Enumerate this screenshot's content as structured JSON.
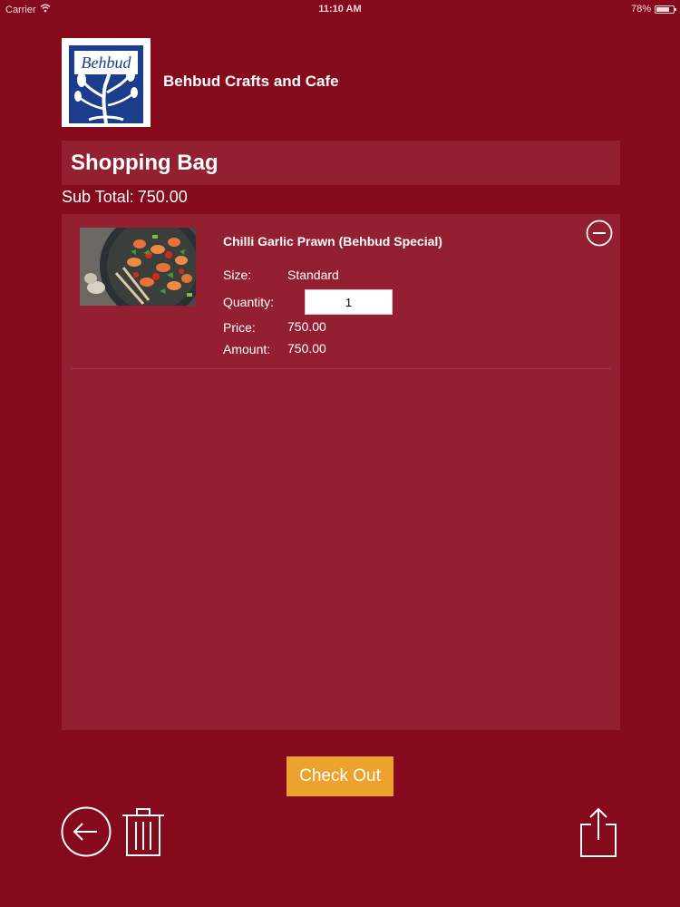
{
  "status_bar": {
    "carrier": "Carrier",
    "time": "11:10 AM",
    "battery": "78%",
    "battery_level": 0.78
  },
  "brand": {
    "name": "Behbud Crafts and Cafe",
    "logo_text": "Behbud"
  },
  "page": {
    "title": "Shopping Bag"
  },
  "summary": {
    "subtotal_label": "Sub Total:",
    "subtotal_value": "750.00"
  },
  "cart": {
    "items": [
      {
        "name": "Chilli Garlic Prawn (Behbud Special)",
        "size_label": "Size:",
        "size_value": "Standard",
        "quantity_label": "Quantity:",
        "quantity_value": "1",
        "price_label": "Price:",
        "price_value": "750.00",
        "amount_label": "Amount:",
        "amount_value": "750.00"
      }
    ]
  },
  "actions": {
    "checkout_label": "Check Out"
  },
  "icons": {
    "back": "back-arrow-icon",
    "trash": "trash-icon",
    "share": "share-icon",
    "remove": "minus-circle-icon",
    "wifi": "wifi-icon"
  },
  "colors": {
    "background": "#850a1b",
    "panel": "#931f30",
    "checkout": "#eea22e",
    "text": "#ffffff",
    "logo_blue": "#1b3d8c"
  }
}
